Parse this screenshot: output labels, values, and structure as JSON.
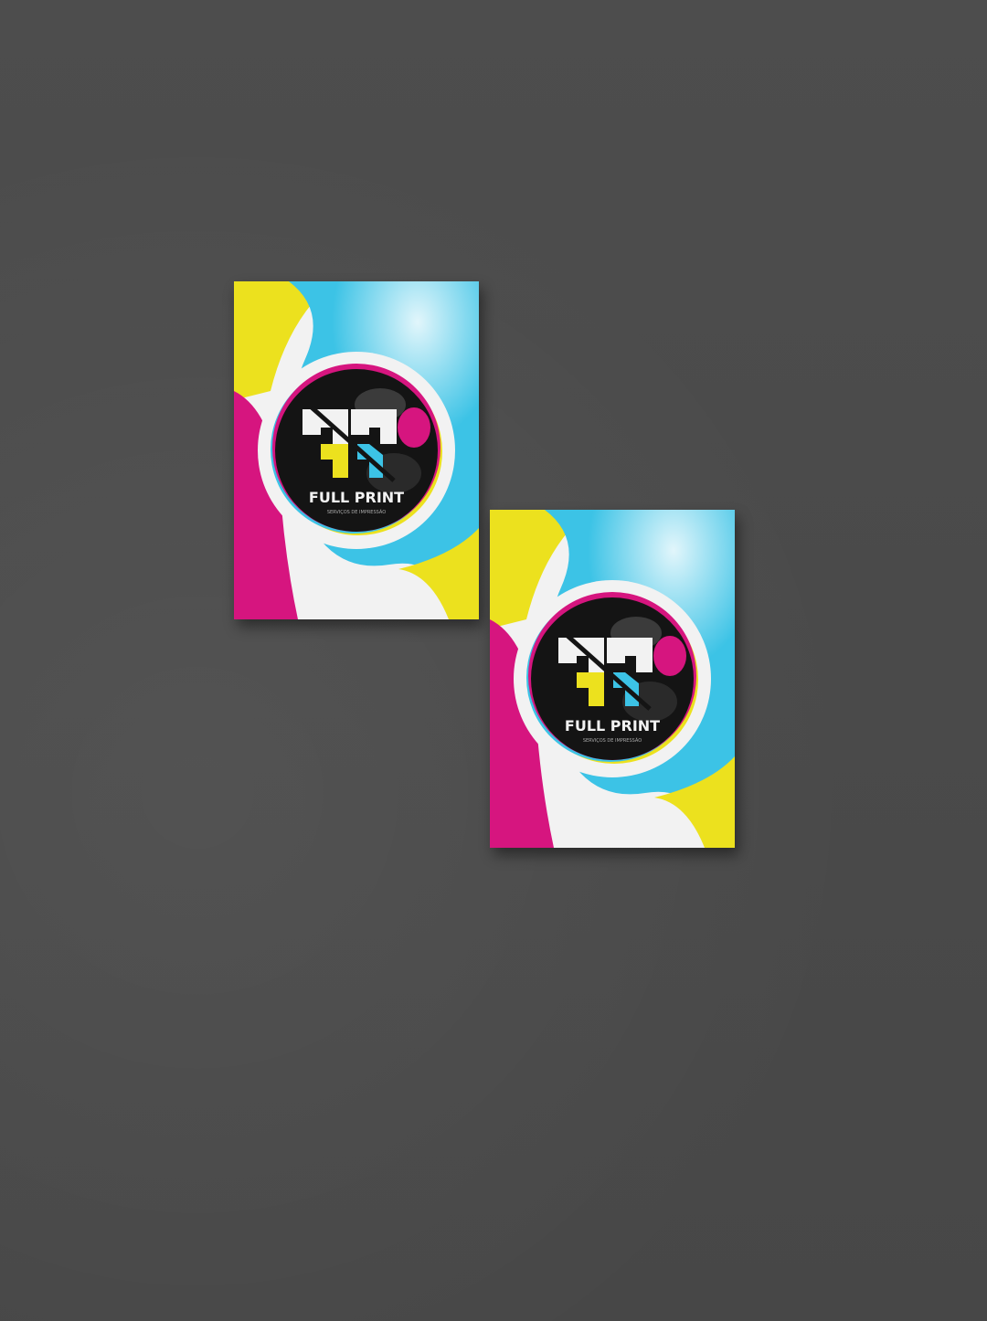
{
  "scene": {
    "background_color": "#4a4a4a",
    "description_colors": {
      "cyan": "#3cc3e6",
      "magenta": "#d6157f",
      "yellow": "#ece11e",
      "black": "#141414",
      "white": "#f2f2f2"
    }
  },
  "cards": [
    {
      "brand_name": "FULL PRINT",
      "tagline": "SERVIÇOS DE IMPRESSÃO",
      "logo_icon": "fp-monogram-icon"
    },
    {
      "brand_name": "FULL PRINT",
      "tagline": "SERVIÇOS DE IMPRESSÃO",
      "logo_icon": "fp-monogram-icon"
    }
  ]
}
